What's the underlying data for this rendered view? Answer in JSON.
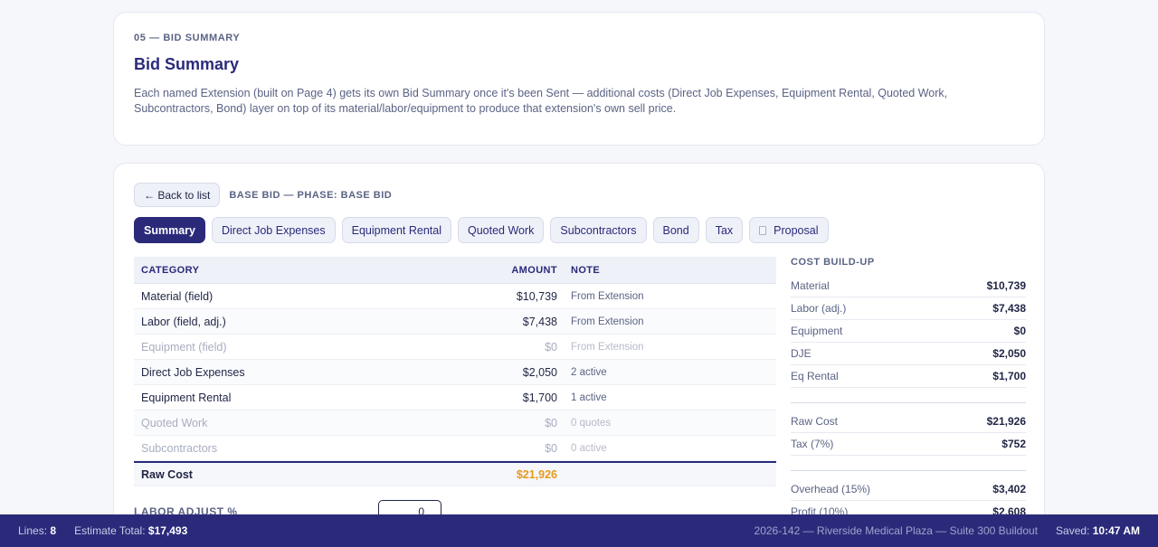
{
  "header": {
    "eyebrow": "05 — BID SUMMARY",
    "title": "Bid Summary",
    "description": "Each named Extension (built on Page 4) gets its own Bid Summary once it's been Sent — additional costs (Direct Job Expenses, Equipment Rental, Quoted Work, Subcontractors, Bond) layer on top of its material/labor/equipment to produce that extension's own sell price."
  },
  "toolbar": {
    "back_label": "← Back to list",
    "phase_label": "BASE BID — PHASE: BASE BID"
  },
  "tabs": [
    {
      "label": "Summary",
      "active": true
    },
    {
      "label": "Direct Job Expenses",
      "active": false
    },
    {
      "label": "Equipment Rental",
      "active": false
    },
    {
      "label": "Quoted Work",
      "active": false
    },
    {
      "label": "Subcontractors",
      "active": false
    },
    {
      "label": "Bond",
      "active": false
    },
    {
      "label": "Tax",
      "active": false
    },
    {
      "label": "Proposal",
      "active": false,
      "icon": "document-icon"
    }
  ],
  "table": {
    "columns": [
      "CATEGORY",
      "AMOUNT",
      "NOTE"
    ],
    "rows": [
      {
        "category": "Material (field)",
        "amount": "$10,739",
        "note": "From Extension"
      },
      {
        "category": "Labor (field, adj.)",
        "amount": "$7,438",
        "note": "From Extension"
      },
      {
        "category": "Equipment (field)",
        "amount": "$0",
        "note": "From Extension"
      },
      {
        "category": "Direct Job Expenses",
        "amount": "$2,050",
        "note": "2 active"
      },
      {
        "category": "Equipment Rental",
        "amount": "$1,700",
        "note": "1 active"
      },
      {
        "category": "Quoted Work",
        "amount": "$0",
        "note": "0 quotes"
      },
      {
        "category": "Subcontractors",
        "amount": "$0",
        "note": "0 active"
      }
    ],
    "total": {
      "category": "Raw Cost",
      "amount": "$21,926"
    }
  },
  "labor_adjust": {
    "label": "LABOR ADJUST %",
    "value": "0"
  },
  "buildup": {
    "title": "COST BUILD-UP",
    "group1": [
      {
        "label": "Material",
        "value": "$10,739"
      },
      {
        "label": "Labor (adj.)",
        "value": "$7,438"
      },
      {
        "label": "Equipment",
        "value": "$0"
      },
      {
        "label": "DJE",
        "value": "$2,050"
      },
      {
        "label": "Eq Rental",
        "value": "$1,700"
      }
    ],
    "group2": [
      {
        "label": "Raw Cost",
        "value": "$21,926"
      },
      {
        "label": "Tax (7%)",
        "value": "$752"
      }
    ],
    "group3": [
      {
        "label": "Overhead (15%)",
        "value": "$3,402"
      },
      {
        "label": "Profit (10%)",
        "value": "$2,608"
      }
    ]
  },
  "status": {
    "lines_label": "Lines:",
    "lines_value": "8",
    "total_label": "Estimate Total:",
    "total_value": "$17,493",
    "project": "2026-142 — Riverside Medical Plaza — Suite 300 Buildout",
    "saved_label": "Saved:",
    "saved_value": "10:47 AM"
  },
  "colors": {
    "brand": "#2b2a7a",
    "accent_total": "#e69a1a"
  }
}
